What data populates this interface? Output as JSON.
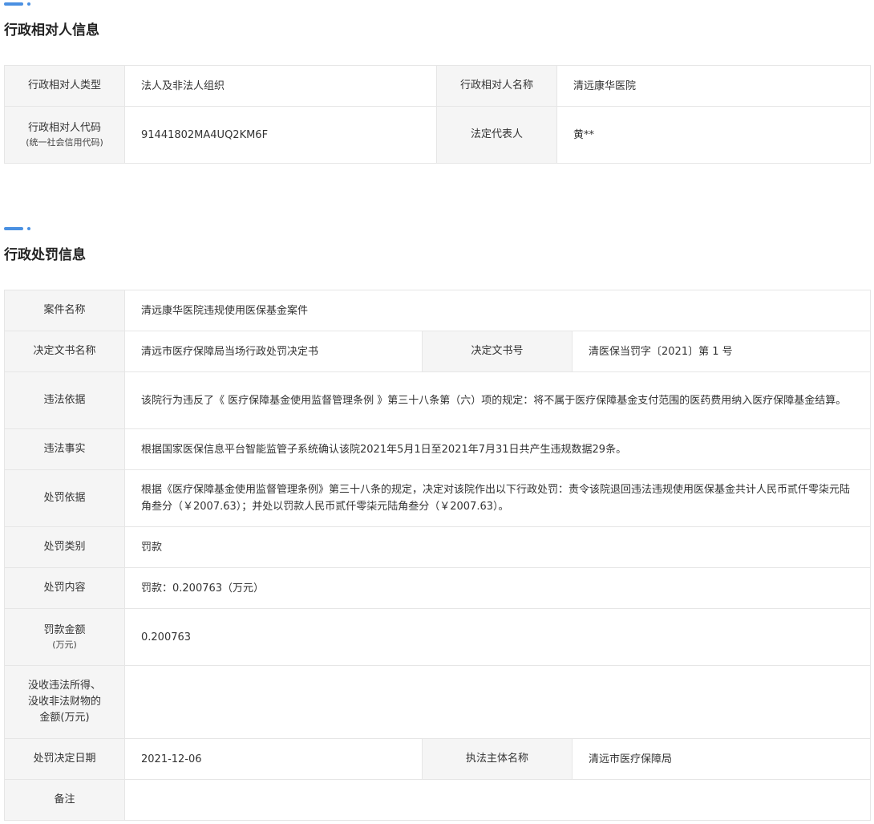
{
  "party_section": {
    "title": "行政相对人信息",
    "type_label": "行政相对人类型",
    "type_value": "法人及非法人组织",
    "name_label": "行政相对人名称",
    "name_value": "清远康华医院",
    "code_label": "行政相对人代码",
    "code_sublabel": "(统一社会信用代码)",
    "code_value": "91441802MA4UQ2KM6F",
    "rep_label": "法定代表人",
    "rep_value": "黄**"
  },
  "penalty_section": {
    "title": "行政处罚信息",
    "case_name_label": "案件名称",
    "case_name_value": "清远康华医院违规使用医保基金案件",
    "doc_name_label": "决定文书名称",
    "doc_name_value": "清远市医疗保障局当场行政处罚决定书",
    "doc_no_label": "决定文书号",
    "doc_no_value": "清医保当罚字〔2021〕第 1 号",
    "violation_basis_label": "违法依据",
    "violation_basis_value": "该院行为违反了《 医疗保障基金使用监督管理条例 》第三十八条第（六）项的规定：将不属于医疗保障基金支付范围的医药费用纳入医疗保障基金结算。",
    "violation_fact_label": "违法事实",
    "violation_fact_value": "根据国家医保信息平台智能监管子系统确认该院2021年5月1日至2021年7月31日共产生违规数据29条。",
    "penalty_basis_label": "处罚依据",
    "penalty_basis_value": "根据《医疗保障基金使用监督管理条例》第三十八条的规定，决定对该院作出以下行政处罚：责令该院退回违法违规使用医保基金共计人民币贰仟零柒元陆角叁分（￥2007.63）；并处以罚款人民币贰仟零柒元陆角叁分（￥2007.63）。",
    "penalty_type_label": "处罚类别",
    "penalty_type_value": "罚款",
    "penalty_content_label": "处罚内容",
    "penalty_content_value": "罚款：0.200763（万元）",
    "fine_amount_label": "罚款金额",
    "fine_amount_unit": "(万元)",
    "fine_amount_value": "0.200763",
    "confiscation_label_line1": "没收违法所得、",
    "confiscation_label_line2": "没收非法财物的",
    "confiscation_label_line3": "金额(万元)",
    "confiscation_value": "",
    "decision_date_label": "处罚决定日期",
    "decision_date_value": "2021-12-06",
    "authority_label": "执法主体名称",
    "authority_value": "清远市医疗保障局",
    "remarks_label": "备注",
    "remarks_value": ""
  },
  "colors": {
    "accent": "#4a90e2",
    "label_bg": "#f5f5f5",
    "border": "#e6e6e6",
    "text": "#333333"
  }
}
